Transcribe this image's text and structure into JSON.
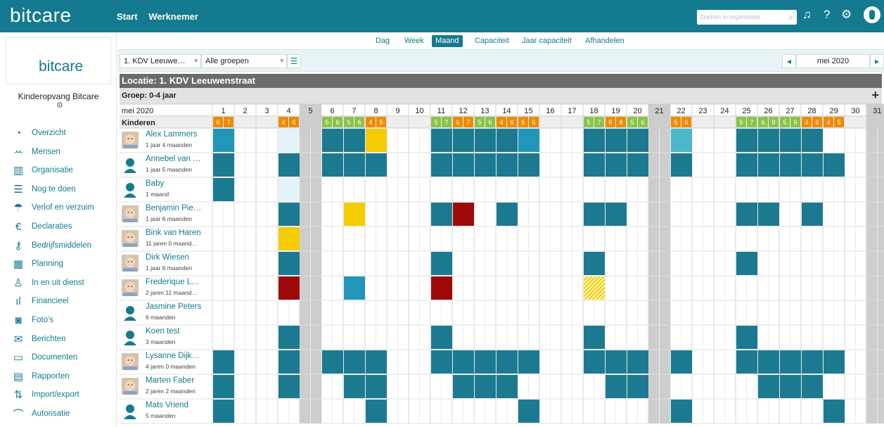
{
  "app": {
    "logo": "bitcare",
    "nav": [
      "Start",
      "Werknemer"
    ],
    "search_placeholder": "Zoeken in organisatie"
  },
  "sidebar": {
    "org_name": "Kinderopvang Bitcare",
    "logo_text": "bitcare",
    "items": [
      {
        "label": "Overzicht",
        "icon": "dashboard-icon",
        "glyph": "◔"
      },
      {
        "label": "Mensen",
        "icon": "people-icon",
        "glyph": "ꕀ"
      },
      {
        "label": "Organisatie",
        "icon": "building-icon",
        "glyph": "▥"
      },
      {
        "label": "Nog te doen",
        "icon": "checklist-icon",
        "glyph": "☰"
      },
      {
        "label": "Verlof en verzuim",
        "icon": "umbrella-icon",
        "glyph": "☂"
      },
      {
        "label": "Declaraties",
        "icon": "euro-icon",
        "glyph": "€"
      },
      {
        "label": "Bedrijfsmiddelen",
        "icon": "key-icon",
        "glyph": "⚷"
      },
      {
        "label": "Planning",
        "icon": "calendar-icon",
        "glyph": "▦"
      },
      {
        "label": "In en uit dienst",
        "icon": "person-check-icon",
        "glyph": "♙"
      },
      {
        "label": "Financieel",
        "icon": "bar-chart-icon",
        "glyph": "ıl"
      },
      {
        "label": "Foto's",
        "icon": "camera-icon",
        "glyph": "◙"
      },
      {
        "label": "Berichten",
        "icon": "messages-icon",
        "glyph": "✉"
      },
      {
        "label": "Documenten",
        "icon": "folder-icon",
        "glyph": "▭"
      },
      {
        "label": "Rapporten",
        "icon": "report-icon",
        "glyph": "▤"
      },
      {
        "label": "Import/export",
        "icon": "import-export-icon",
        "glyph": "⇅"
      },
      {
        "label": "Autorisatie",
        "icon": "lock-open-icon",
        "glyph": "⌒"
      }
    ]
  },
  "subnav": {
    "tabs": [
      "Dag",
      "Week",
      "Maand",
      "Capaciteit",
      "Jaar capaciteit",
      "Afhandelen"
    ],
    "active": "Maand"
  },
  "filters": {
    "location": "1. KDV Leeuwe…",
    "group": "Alle groepen",
    "month": "mei 2020"
  },
  "grid": {
    "location_title": "Locatie: 1. KDV Leeuwenstraat",
    "group_title": "Groep: 0-4 jaar",
    "month_label": "mei 2020",
    "children_header": "Kinderen",
    "days": [
      1,
      2,
      3,
      4,
      5,
      6,
      7,
      8,
      9,
      10,
      11,
      12,
      13,
      14,
      15,
      16,
      17,
      18,
      19,
      20,
      21,
      22,
      23,
      24,
      25,
      26,
      27,
      28,
      29,
      30,
      31
    ],
    "weekend_days": [
      5,
      21,
      31
    ],
    "counts": [
      {
        "day": 1,
        "am": "6",
        "pm": "7",
        "color": "#f08a00"
      },
      {
        "day": 4,
        "am": "4",
        "pm": "6",
        "color": "#f08a00"
      },
      {
        "day": 6,
        "am": "5",
        "pm": "6",
        "color": "#8bc34a"
      },
      {
        "day": 7,
        "am": "5",
        "pm": "6",
        "color": "#8bc34a"
      },
      {
        "day": 8,
        "am": "4",
        "pm": "5",
        "color": "#f08a00"
      },
      {
        "day": 11,
        "am": "5",
        "pm": "7",
        "color": "#8bc34a"
      },
      {
        "day": 12,
        "am": "6",
        "pm": "7",
        "color": "#f08a00"
      },
      {
        "day": 13,
        "am": "5",
        "pm": "6",
        "color": "#8bc34a"
      },
      {
        "day": 14,
        "am": "4",
        "pm": "6",
        "color": "#f08a00"
      },
      {
        "day": 15,
        "am": "5",
        "pm": "6",
        "color": "#f08a00"
      },
      {
        "day": 18,
        "am": "5",
        "pm": "7",
        "color": "#8bc34a"
      },
      {
        "day": 19,
        "am": "6",
        "pm": "8",
        "color": "#f08a00"
      },
      {
        "day": 20,
        "am": "5",
        "pm": "6",
        "color": "#8bc34a"
      },
      {
        "day": 22,
        "am": "5",
        "pm": "6",
        "color": "#f08a00"
      },
      {
        "day": 25,
        "am": "5",
        "pm": "7",
        "color": "#8bc34a"
      },
      {
        "day": 26,
        "am": "6",
        "pm": "8",
        "color": "#8bc34a"
      },
      {
        "day": 27,
        "am": "5",
        "pm": "6",
        "color": "#8bc34a"
      },
      {
        "day": 28,
        "am": "4",
        "pm": "6",
        "color": "#f08a00"
      },
      {
        "day": 29,
        "am": "4",
        "pm": "5",
        "color": "#f08a00"
      }
    ],
    "children": [
      {
        "name": "Alex Lammers",
        "age": "1 jaar 4 maanden",
        "photo": "baby-photo",
        "blocks": [
          [
            1,
            "#2196b8"
          ],
          [
            4,
            "#e4f3f7"
          ],
          [
            6,
            "#1b7a90"
          ],
          [
            7,
            "#1b7a90"
          ],
          [
            8,
            "#f5cc00"
          ],
          [
            11,
            "#1b7a90"
          ],
          [
            12,
            "#1b7a90"
          ],
          [
            13,
            "#1b7a90"
          ],
          [
            14,
            "#1b7a90"
          ],
          [
            15,
            "#2196b8"
          ],
          [
            18,
            "#1b7a90"
          ],
          [
            19,
            "#1b7a90"
          ],
          [
            20,
            "#1b7a90"
          ],
          [
            22,
            "#4bb7cc"
          ],
          [
            25,
            "#1b7a90"
          ],
          [
            26,
            "#1b7a90"
          ],
          [
            27,
            "#1b7a90"
          ],
          [
            28,
            "#1b7a90"
          ]
        ]
      },
      {
        "name": "Annebel van …",
        "age": "1 jaar 5 maanden",
        "photo": "silhouette-girl",
        "blocks": [
          [
            1,
            "#1b7a90"
          ],
          [
            4,
            "#1b7a90"
          ],
          [
            6,
            "#1b7a90"
          ],
          [
            7,
            "#1b7a90"
          ],
          [
            8,
            "#1b7a90"
          ],
          [
            11,
            "#1b7a90"
          ],
          [
            12,
            "#1b7a90"
          ],
          [
            13,
            "#1b7a90"
          ],
          [
            14,
            "#1b7a90"
          ],
          [
            15,
            "#1b7a90"
          ],
          [
            18,
            "#1b7a90"
          ],
          [
            19,
            "#1b7a90"
          ],
          [
            20,
            "#1b7a90"
          ],
          [
            22,
            "#1b7a90"
          ],
          [
            25,
            "#1b7a90"
          ],
          [
            26,
            "#1b7a90"
          ],
          [
            27,
            "#1b7a90"
          ],
          [
            28,
            "#1b7a90"
          ],
          [
            29,
            "#1b7a90"
          ]
        ]
      },
      {
        "name": "Baby",
        "age": "1 maand",
        "photo": "silhouette-boy",
        "blocks": [
          [
            1,
            "#1b7a90"
          ],
          [
            4,
            "#e4f3f7"
          ]
        ]
      },
      {
        "name": "Benjamin Pie…",
        "age": "1 jaar 6 maanden",
        "photo": "baby-photo-2",
        "blocks": [
          [
            4,
            "#1b7a90"
          ],
          [
            7,
            "#f5cc00"
          ],
          [
            11,
            "#1b7a90"
          ],
          [
            12,
            "#9e0a0a"
          ],
          [
            14,
            "#1b7a90"
          ],
          [
            18,
            "#1b7a90"
          ],
          [
            19,
            "#1b7a90"
          ],
          [
            25,
            "#1b7a90"
          ],
          [
            26,
            "#1b7a90"
          ],
          [
            28,
            "#1b7a90"
          ]
        ]
      },
      {
        "name": "Bink van Haren",
        "age": "11 jaren 0 maand…",
        "photo": "child-photo",
        "blocks": [
          [
            4,
            "#f5cc00"
          ]
        ]
      },
      {
        "name": "Dirk Wiesen",
        "age": "1 jaar 6 maanden",
        "photo": "baby-photo-3",
        "blocks": [
          [
            4,
            "#1b7a90"
          ],
          [
            11,
            "#1b7a90"
          ],
          [
            18,
            "#1b7a90"
          ],
          [
            25,
            "#1b7a90"
          ]
        ]
      },
      {
        "name": "Frederique L…",
        "age": "2 jaren 11 maand…",
        "photo": "baby-photo-4",
        "blocks": [
          [
            4,
            "#9e0a0a"
          ],
          [
            7,
            "#2196b8"
          ],
          [
            11,
            "#9e0a0a"
          ],
          [
            18,
            "hatch"
          ]
        ]
      },
      {
        "name": "Jasmine Peters",
        "age": "6 maanden",
        "photo": "silhouette-girl",
        "blocks": []
      },
      {
        "name": "Koen test",
        "age": "3 maanden",
        "photo": "silhouette-boy",
        "blocks": [
          [
            4,
            "#1b7a90"
          ],
          [
            11,
            "#1b7a90"
          ],
          [
            18,
            "#1b7a90"
          ],
          [
            25,
            "#1b7a90"
          ]
        ]
      },
      {
        "name": "Lysanne Dijk…",
        "age": "4 jaren 0 maanden",
        "photo": "baby-photo-5",
        "blocks": [
          [
            1,
            "#1b7a90"
          ],
          [
            4,
            "#1b7a90"
          ],
          [
            6,
            "#1b7a90"
          ],
          [
            7,
            "#1b7a90"
          ],
          [
            8,
            "#1b7a90"
          ],
          [
            11,
            "#1b7a90"
          ],
          [
            12,
            "#1b7a90"
          ],
          [
            13,
            "#1b7a90"
          ],
          [
            14,
            "#1b7a90"
          ],
          [
            15,
            "#1b7a90"
          ],
          [
            18,
            "#1b7a90"
          ],
          [
            19,
            "#1b7a90"
          ],
          [
            20,
            "#1b7a90"
          ],
          [
            22,
            "#1b7a90"
          ],
          [
            25,
            "#1b7a90"
          ],
          [
            26,
            "#1b7a90"
          ],
          [
            27,
            "#1b7a90"
          ],
          [
            28,
            "#1b7a90"
          ],
          [
            29,
            "#1b7a90"
          ]
        ]
      },
      {
        "name": "Marten Faber",
        "age": "2 jaren 2 maanden",
        "photo": "baby-photo-6",
        "blocks": [
          [
            1,
            "#1b7a90"
          ],
          [
            4,
            "#1b7a90"
          ],
          [
            7,
            "#1b7a90"
          ],
          [
            8,
            "#1b7a90"
          ],
          [
            12,
            "#1b7a90"
          ],
          [
            13,
            "#1b7a90"
          ],
          [
            14,
            "#1b7a90"
          ],
          [
            19,
            "#1b7a90"
          ],
          [
            20,
            "#1b7a90"
          ],
          [
            26,
            "#1b7a90"
          ],
          [
            27,
            "#1b7a90"
          ],
          [
            28,
            "#1b7a90"
          ]
        ]
      },
      {
        "name": "Mats Vriend",
        "age": "5 maanden",
        "photo": "silhouette-boy",
        "blocks": [
          [
            1,
            "#1b7a90"
          ],
          [
            8,
            "#1b7a90"
          ],
          [
            15,
            "#1b7a90"
          ],
          [
            22,
            "#1b7a90"
          ],
          [
            29,
            "#1b7a90"
          ]
        ]
      }
    ]
  }
}
